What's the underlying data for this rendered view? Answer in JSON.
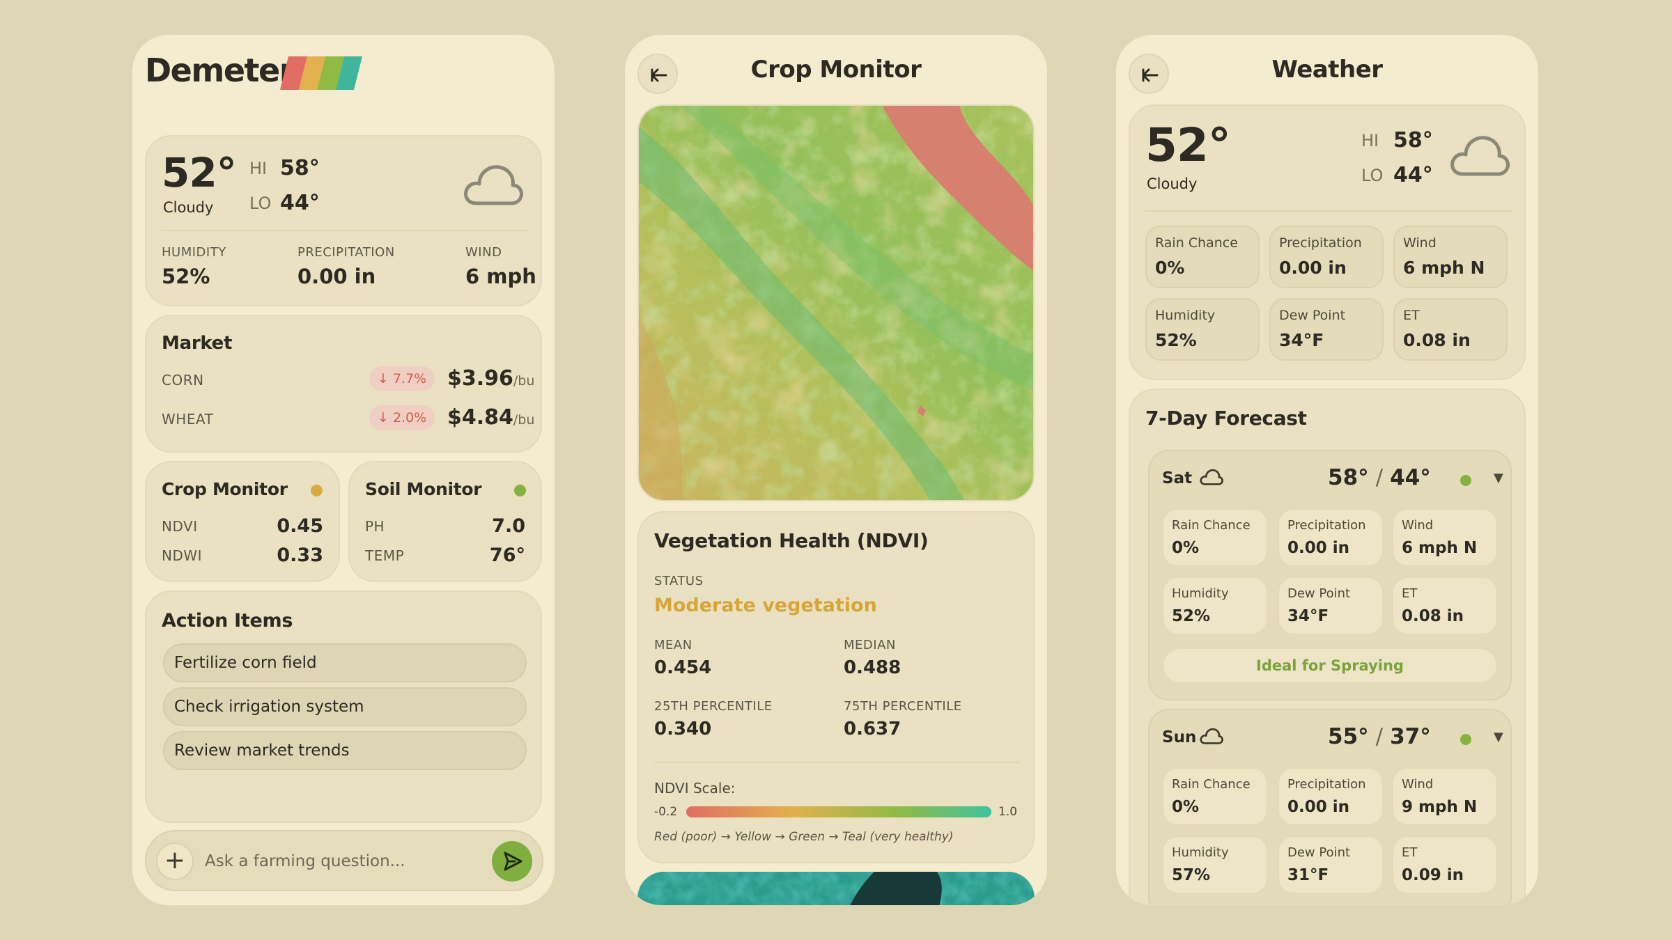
{
  "colors": {
    "background": "#ddd7b6",
    "panel": "#f3ecce",
    "accent_green": "#7fad3e",
    "status_yellow": "#d8ac45",
    "down_red": "#d25d52",
    "status_text": "#d6a63a",
    "brand_stripes": [
      "#e06e63",
      "#e2b04f",
      "#8fbb45",
      "#3fb59c"
    ]
  },
  "home": {
    "brand": "Demeter",
    "weather": {
      "temp": "52°",
      "condition": "Cloudy",
      "icon": "cloud-icon",
      "hi_label": "HI",
      "hi": "58°",
      "lo_label": "LO",
      "lo": "44°",
      "stats": [
        {
          "label": "HUMIDITY",
          "value": "52%"
        },
        {
          "label": "PRECIPITATION",
          "value": "0.00 in"
        },
        {
          "label": "WIND",
          "value": "6 mph"
        }
      ]
    },
    "market": {
      "title": "Market",
      "items": [
        {
          "name": "CORN",
          "change": "↓ 7.7%",
          "price": "$3.96",
          "unit": "/bu"
        },
        {
          "name": "WHEAT",
          "change": "↓ 2.0%",
          "price": "$4.84",
          "unit": "/bu"
        }
      ]
    },
    "crop_monitor": {
      "title": "Crop Monitor",
      "status_color": "#d8ac45",
      "rows": [
        {
          "label": "NDVI",
          "value": "0.45"
        },
        {
          "label": "NDWI",
          "value": "0.33"
        }
      ]
    },
    "soil_monitor": {
      "title": "Soil Monitor",
      "status_color": "#86b23f",
      "rows": [
        {
          "label": "PH",
          "value": "7.0"
        },
        {
          "label": "TEMP",
          "value": "76°"
        }
      ]
    },
    "actions": {
      "title": "Action Items",
      "items": [
        "Fertilize corn field",
        "Check irrigation system",
        "Review market trends"
      ]
    },
    "chat": {
      "placeholder": "Ask a farming question...",
      "add_icon": "plus-icon",
      "send_icon": "send-icon"
    }
  },
  "crop": {
    "title": "Crop Monitor",
    "back_icon": "arrow-left-icon",
    "panel_title": "Vegetation Health (NDVI)",
    "status_label": "STATUS",
    "status": "Moderate vegetation",
    "stats": [
      {
        "label": "MEAN",
        "value": "0.454"
      },
      {
        "label": "MEDIAN",
        "value": "0.488"
      },
      {
        "label": "25TH PERCENTILE",
        "value": "0.340"
      },
      {
        "label": "75TH PERCENTILE",
        "value": "0.637"
      }
    ],
    "scale_label": "NDVI Scale:",
    "scale_min": "-0.2",
    "scale_max": "1.0",
    "scale_note": "Red (poor) → Yellow → Green → Teal (very healthy)"
  },
  "weather": {
    "title": "Weather",
    "back_icon": "arrow-left-icon",
    "temp": "52°",
    "condition": "Cloudy",
    "hi_label": "HI",
    "hi": "58°",
    "lo_label": "LO",
    "lo": "44°",
    "stats": [
      {
        "label": "Rain Chance",
        "value": "0%"
      },
      {
        "label": "Precipitation",
        "value": "0.00 in"
      },
      {
        "label": "Wind",
        "value": "6 mph N"
      },
      {
        "label": "Humidity",
        "value": "52%"
      },
      {
        "label": "Dew Point",
        "value": "34°F"
      },
      {
        "label": "ET",
        "value": "0.08 in"
      }
    ],
    "forecast_title": "7-Day Forecast",
    "days": [
      {
        "day": "Sat",
        "hi": "58°",
        "lo": "44°",
        "sep": "/",
        "dot_color": "#86b23f",
        "stats": [
          {
            "label": "Rain Chance",
            "value": "0%"
          },
          {
            "label": "Precipitation",
            "value": "0.00 in"
          },
          {
            "label": "Wind",
            "value": "6 mph N"
          },
          {
            "label": "Humidity",
            "value": "52%"
          },
          {
            "label": "Dew Point",
            "value": "34°F"
          },
          {
            "label": "ET",
            "value": "0.08 in"
          }
        ],
        "note": "Ideal for Spraying"
      },
      {
        "day": "Sun",
        "hi": "55°",
        "lo": "37°",
        "sep": "/",
        "dot_color": "#86b23f",
        "stats": [
          {
            "label": "Rain Chance",
            "value": "0%"
          },
          {
            "label": "Precipitation",
            "value": "0.00 in"
          },
          {
            "label": "Wind",
            "value": "9 mph N"
          },
          {
            "label": "Humidity",
            "value": "57%"
          },
          {
            "label": "Dew Point",
            "value": "31°F"
          },
          {
            "label": "ET",
            "value": "0.09 in"
          }
        ]
      }
    ]
  }
}
